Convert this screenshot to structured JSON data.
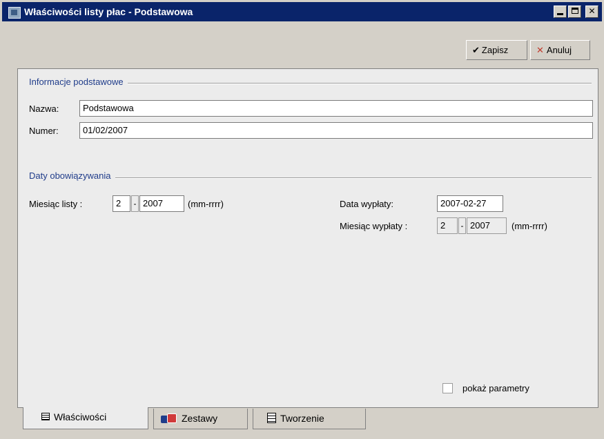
{
  "window": {
    "title": "Właściwości listy płac - Podstawowa",
    "controls": {
      "minimize": "_",
      "maximize": "□",
      "close": "✕"
    }
  },
  "toolbar": {
    "save_label": "Zapisz",
    "cancel_label": "Anuluj",
    "save_icon": "check-icon",
    "cancel_icon": "close-icon"
  },
  "basic_info": {
    "header": "Informacje podstawowe",
    "name_label": "Nazwa:",
    "name_value": "Podstawowa",
    "number_label": "Numer:",
    "number_value": "01/02/2007"
  },
  "dates": {
    "header": "Daty obowiązywania",
    "list_month_label": "Miesiąc listy :",
    "list_month": "2",
    "list_separator": "-",
    "list_year": "2007",
    "list_format": "(mm-rrrr)",
    "payment_date_label": "Data wypłaty:",
    "payment_date": "2007-02-27",
    "payment_month_label": "Miesiąc wypłaty :",
    "payment_month": "2",
    "payment_separator": "-",
    "payment_year": "2007",
    "payment_format": "(mm-rrrr)"
  },
  "options": {
    "show_params_label": "pokaż parametry",
    "show_params_checked": false
  },
  "tabs": [
    {
      "label": "Właściwości",
      "icon": "list-icon",
      "active": true
    },
    {
      "label": "Zestawy",
      "icon": "sets-icon",
      "active": false
    },
    {
      "label": "Tworzenie",
      "icon": "document-icon",
      "active": false
    }
  ],
  "colors": {
    "title_bar": "#0a246a",
    "group_header": "#1f3c8a",
    "cancel_icon": "#c0392b"
  }
}
